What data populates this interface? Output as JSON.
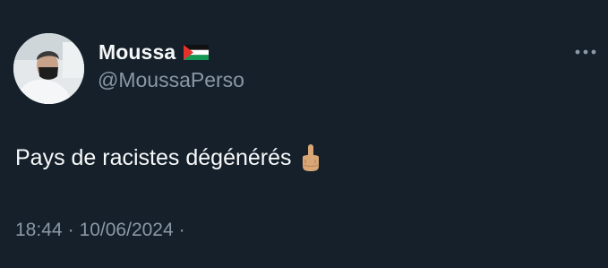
{
  "tweet": {
    "display_name": "Moussa",
    "flag_icon": "palestine-flag-icon",
    "handle": "@MoussaPerso",
    "text": "Pays de racistes dégénérés",
    "emoji_icon": "middle-finger-emoji",
    "time": "18:44",
    "date": "10/06/2024",
    "separator": "·",
    "more_icon": "more-options-icon"
  },
  "colors": {
    "background": "#15202b",
    "primary_text": "#f7f9f9",
    "secondary_text": "#8b98a5"
  }
}
